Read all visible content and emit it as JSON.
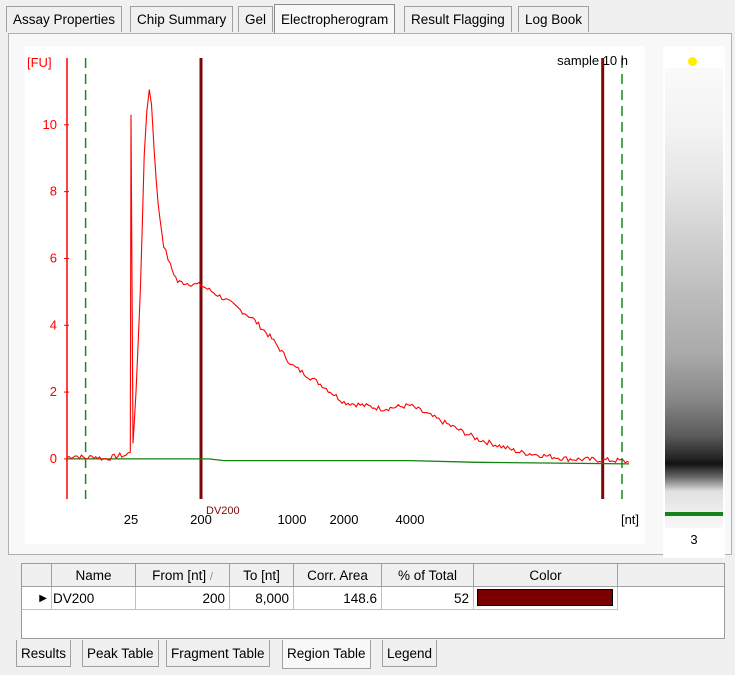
{
  "top_tabs": [
    "Assay Properties",
    "Chip Summary",
    "Gel",
    "Electropherogram",
    "Result Flagging",
    "Log Book"
  ],
  "active_top_tab": "Electropherogram",
  "chart": {
    "sample_label": "sample  10 h",
    "ylabel": "[FU]",
    "xlabel": "[nt]",
    "region_label": "DV200",
    "colors": {
      "trace": "#ff0000",
      "axis": "#ff0000",
      "baseline": "#128212",
      "region": "#7a0a0a",
      "marker": "#1a8a1a"
    }
  },
  "chart_data": {
    "type": "line",
    "ylabel": "[FU]",
    "xlabel": "[nt]",
    "ylim": [
      -1.2,
      12
    ],
    "yticks": [
      0,
      2,
      4,
      6,
      8,
      10
    ],
    "xticks": [
      25,
      200,
      1000,
      2000,
      4000
    ],
    "series": [
      {
        "points": [
          [
            -61,
            0.05
          ],
          [
            -50,
            0.1
          ],
          [
            -36,
            0.02
          ],
          [
            -25,
            0.08
          ],
          [
            -12,
            0.0
          ],
          [
            0,
            0.05
          ],
          [
            10,
            0.1
          ],
          [
            18,
            0.1
          ],
          [
            24,
            0.2
          ],
          [
            25,
            10.3
          ],
          [
            26.5,
            0.5
          ],
          [
            29,
            2.0
          ],
          [
            33,
            5.0
          ],
          [
            37,
            9.0
          ],
          [
            40,
            10.4
          ],
          [
            43,
            11.1
          ],
          [
            46,
            10.6
          ],
          [
            50,
            9.2
          ],
          [
            56,
            7.6
          ],
          [
            66,
            6.4
          ],
          [
            80,
            5.8
          ],
          [
            100,
            5.3
          ],
          [
            200,
            5.2
          ],
          [
            300,
            4.8
          ],
          [
            500,
            4.2
          ],
          [
            700,
            3.6
          ],
          [
            1000,
            2.8
          ],
          [
            1500,
            2.2
          ],
          [
            2000,
            1.7
          ],
          [
            3000,
            1.5
          ],
          [
            4000,
            1.6
          ],
          [
            5000,
            1.2
          ],
          [
            7000,
            0.6
          ],
          [
            10000,
            0.2
          ],
          [
            15000,
            0.0
          ],
          [
            23000,
            -0.05
          ],
          [
            26000,
            -0.1
          ]
        ]
      }
    ],
    "baseline": [
      [
        -61,
        0.0
      ],
      [
        230,
        0.0
      ],
      [
        300,
        -0.05
      ],
      [
        4000,
        -0.05
      ],
      [
        7000,
        -0.1
      ],
      [
        26000,
        -0.15
      ]
    ],
    "region": {
      "name": "DV200",
      "from": 200,
      "to": 20000
    },
    "markers": [
      -36,
      23500
    ]
  },
  "gel": {
    "lane_label": "3",
    "colors": {
      "marker_dot": "#ffee00",
      "lower_marker": "#16821a"
    }
  },
  "region_table": {
    "headers": [
      "Name",
      "From [nt]",
      "To [nt]",
      "Corr. Area",
      "% of Total",
      "Color"
    ],
    "sort_glyph": "/",
    "rows": [
      {
        "indicator": "▶",
        "name": "DV200",
        "from": "200",
        "to": "8,000",
        "area": "148.6",
        "pct": "52",
        "color": "#7a0000"
      }
    ]
  },
  "bottom_tabs": [
    "Results",
    "Peak Table",
    "Fragment Table",
    "Region Table",
    "Legend"
  ],
  "active_bottom_tab": "Region Table"
}
